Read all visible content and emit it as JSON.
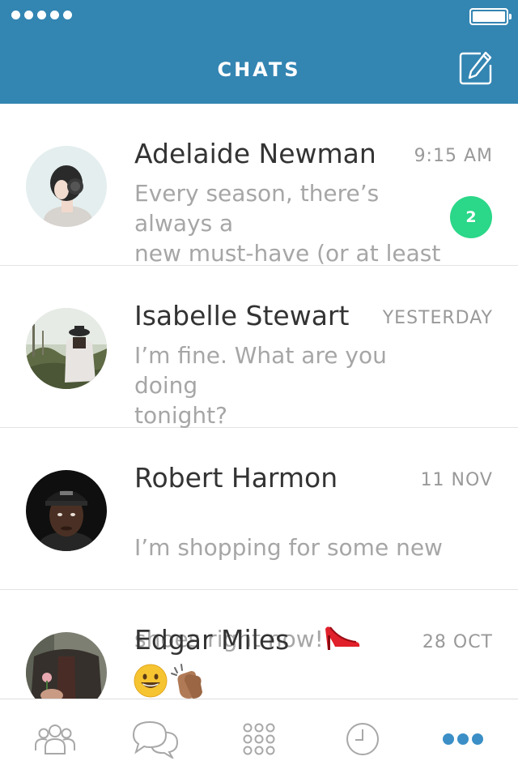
{
  "header": {
    "title": "CHATS",
    "signal_dots": 5,
    "battery_level": 1.0
  },
  "colors": {
    "header": "#3385b2",
    "badge": "#2bd788",
    "active_tab": "#3b8fc6",
    "inactive_tab": "#a8a8a8"
  },
  "chats": [
    {
      "name": "Adelaide Newman",
      "time": "9:15 AM",
      "preview": "Every season, there’s always a\nnew must-have (or at least",
      "unread": "2",
      "avatar": "photo-woman-headphones"
    },
    {
      "name": "Isabelle Stewart",
      "time": "YESTERDAY",
      "preview": "I’m fine. What are you doing\ntonight?",
      "avatar": "photo-woman-field"
    },
    {
      "name": "Robert Harmon",
      "time": "11 NOV",
      "preview_line1": "I’m shopping for some new",
      "preview_line2": "shoes right now!",
      "preview_emoji": "high-heel-icon",
      "avatar": "photo-man-cap"
    },
    {
      "name": "Edgar Miles",
      "time": "28 OCT",
      "preview_emojis": [
        "grinning-face-icon",
        "clapping-hands-icon"
      ],
      "avatar": "photo-man-flower"
    }
  ],
  "tabs": [
    {
      "icon": "contacts-icon",
      "active": false
    },
    {
      "icon": "chats-icon",
      "active": false
    },
    {
      "icon": "apps-grid-icon",
      "active": false
    },
    {
      "icon": "recent-clock-icon",
      "active": false
    },
    {
      "icon": "more-icon",
      "active": true
    }
  ]
}
